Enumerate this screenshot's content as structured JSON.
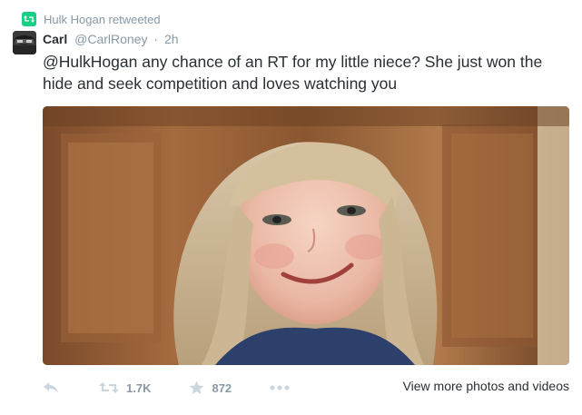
{
  "retweet_notice": {
    "text": "Hulk Hogan retweeted",
    "icon": "retweet-icon",
    "icon_color": "#19cf86"
  },
  "author": {
    "name": "Carl",
    "handle": "@CarlRoney",
    "separator": "·",
    "time": "2h"
  },
  "tweet": {
    "mention": "@HulkHogan",
    "text": " any chance of an RT for my little niece? She just won the hide and seek competition and loves watching you"
  },
  "media": {
    "type": "photo",
    "alt": ""
  },
  "actions": {
    "reply_icon": "reply-icon",
    "retweet_icon": "retweet-icon",
    "retweet_count": "1.7K",
    "favorite_icon": "star-icon",
    "favorite_count": "872",
    "more_icon": "more-dots-icon",
    "view_more_label": "View more photos and videos"
  },
  "colors": {
    "text": "#292f33",
    "muted": "#8899a6",
    "retweet_green": "#19cf86"
  }
}
